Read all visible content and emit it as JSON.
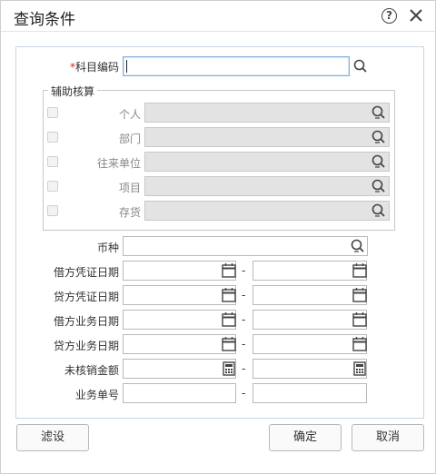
{
  "dialog": {
    "title": "查询条件",
    "help_glyph": "?"
  },
  "subject_code": {
    "required_mark": "*",
    "label": "科目编码",
    "value": ""
  },
  "aux": {
    "legend": "辅助核算",
    "items": [
      {
        "label": "个人"
      },
      {
        "label": "部门"
      },
      {
        "label": "往来单位"
      },
      {
        "label": "项目"
      },
      {
        "label": "存货"
      }
    ]
  },
  "currency": {
    "label": "币种"
  },
  "ranges": [
    {
      "label": "借方凭证日期",
      "separator": "-",
      "icon": "calendar-icon"
    },
    {
      "label": "贷方凭证日期",
      "separator": "-",
      "icon": "calendar-icon"
    },
    {
      "label": "借方业务日期",
      "separator": "-",
      "icon": "calendar-icon"
    },
    {
      "label": "贷方业务日期",
      "separator": "-",
      "icon": "calendar-icon"
    },
    {
      "label": "未核销金额",
      "separator": "-",
      "icon": "calculator-icon"
    },
    {
      "label": "业务单号",
      "separator": "-",
      "icon": ""
    }
  ],
  "buttons": {
    "filter": "滤设",
    "ok": "确定",
    "cancel": "取消"
  },
  "colors": {
    "focus_border": "#7fb0dd",
    "disabled_bg": "#e3e3e3",
    "required": "#e02020",
    "panel_border": "#c9d6e2"
  }
}
